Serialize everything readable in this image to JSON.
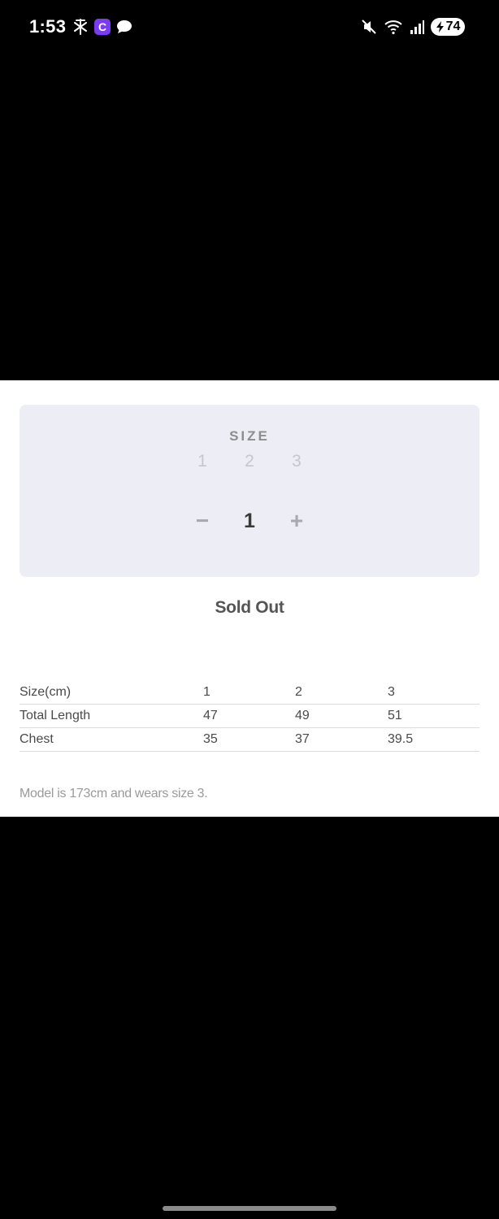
{
  "status_bar": {
    "time": "1:53",
    "left_icons": [
      "feather-app-icon",
      "c-app-icon",
      "chat-bubble-icon"
    ],
    "c_app_letter": "C",
    "right_icons": [
      "mute-icon",
      "wifi-icon",
      "signal-icon"
    ],
    "battery": "74",
    "colors": {
      "c_app": "#7a3cf0"
    }
  },
  "product": {
    "size_label": "SIZE",
    "sizes": [
      "1",
      "2",
      "3"
    ],
    "quantity": {
      "minus": "−",
      "value": "1",
      "plus": "+"
    },
    "availability": "Sold Out"
  },
  "size_chart": {
    "headers": [
      "Size(cm)",
      "1",
      "2",
      "3"
    ],
    "rows": [
      [
        "Total Length",
        "47",
        "49",
        "51"
      ],
      [
        "Chest",
        "35",
        "37",
        "39.5"
      ]
    ]
  },
  "model_note": "Model is 173cm and wears size 3.",
  "colors": {
    "card_bg": "#ededf6",
    "backdrop": "#000000"
  }
}
